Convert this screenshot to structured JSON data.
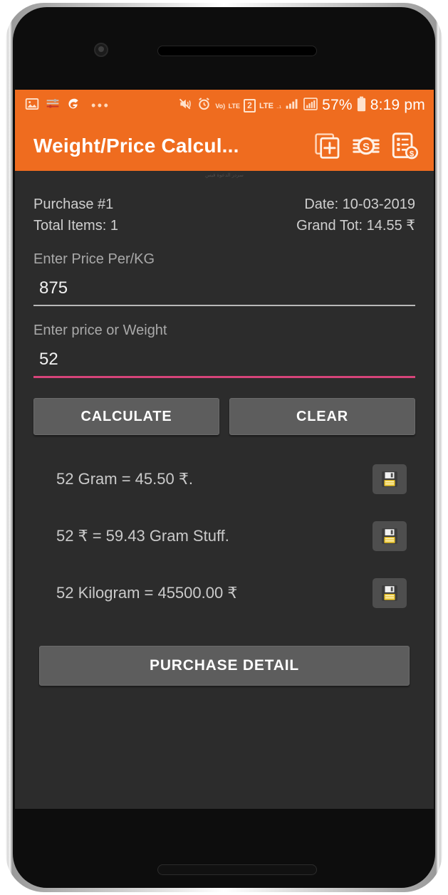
{
  "status_bar": {
    "left_icons": [
      {
        "name": "gallery-icon"
      },
      {
        "name": "sliders-icon"
      },
      {
        "name": "g-logo-icon"
      }
    ],
    "more_icons": "•••",
    "right_icons": [
      {
        "name": "vibrate-mute-icon"
      },
      {
        "name": "alarm-clock-icon"
      },
      {
        "name": "volte-icon",
        "line1": "Vo)",
        "line2": "LTE"
      },
      {
        "name": "sim2-icon",
        "label": "2"
      },
      {
        "name": "lte-icon",
        "label": "LTE"
      },
      {
        "name": "signal-bars-sim1-icon"
      },
      {
        "name": "signal-bars-sim2-icon"
      }
    ],
    "battery_percent": "57%",
    "time": "8:19 pm"
  },
  "app_bar": {
    "title": "Weight/Price Calcul...",
    "actions": [
      {
        "name": "add-purchase-icon",
        "label": "Add Purchase"
      },
      {
        "name": "coins-dollar-icon",
        "label": "Money"
      },
      {
        "name": "invoice-dollar-icon",
        "label": "Invoice"
      }
    ]
  },
  "watermark": "سردر الدعوة فيس",
  "purchase": {
    "number_label": "Purchase #1",
    "total_items_label": "Total Items: 1",
    "date_label": "Date: 10-03-2019",
    "grand_total_label": "Grand Tot: 14.55 ₹"
  },
  "fields": {
    "price_per_kg": {
      "label": "Enter Price Per/KG",
      "value": "875",
      "placeholder": "Enter Price Per/KG"
    },
    "price_or_weight": {
      "label": "Enter price or Weight",
      "value": "52",
      "placeholder": "Enter price or Weight",
      "focused": true
    }
  },
  "buttons": {
    "calculate": "CALCULATE",
    "clear": "CLEAR",
    "purchase_detail": "PURCHASE DETAIL"
  },
  "results": [
    {
      "text": "52 Gram = 45.50 ₹.",
      "save_icon": "save-floppy-icon"
    },
    {
      "text": "52 ₹ = 59.43 Gram Stuff.",
      "save_icon": "save-floppy-icon"
    },
    {
      "text": "52 Kilogram = 45500.00 ₹",
      "save_icon": "save-floppy-icon"
    }
  ],
  "colors": {
    "accent_orange": "#ef6c1f",
    "background_dark": "#2c2c2c",
    "button_gray": "#5d5d5d",
    "focus_pink": "#d6447a",
    "save_icon_yellow": "#e8c22a"
  }
}
